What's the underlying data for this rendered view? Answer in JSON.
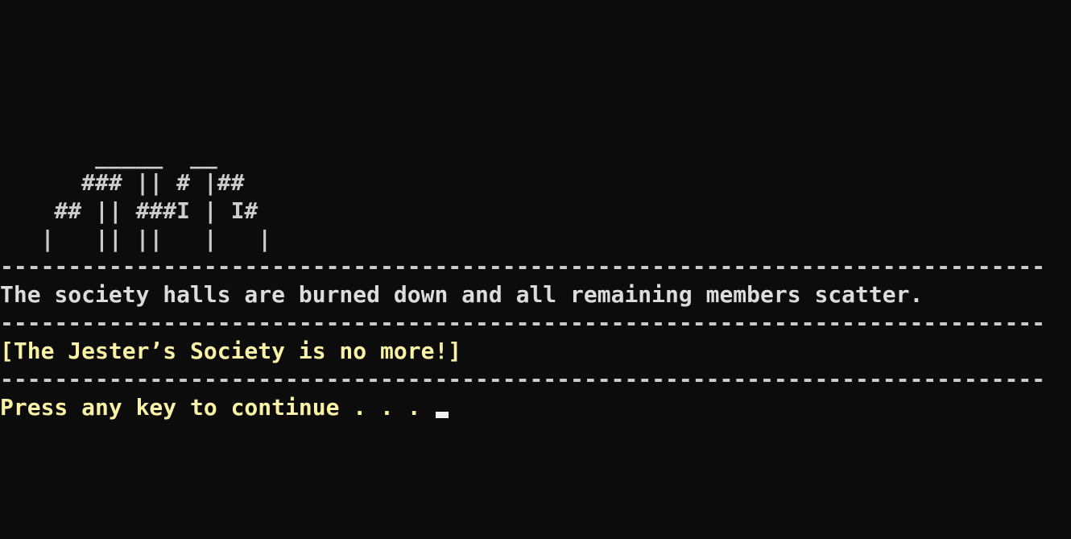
{
  "art_lines": [
    "       _____  __",
    "      ### || # |##",
    "    ## || ###I | I#",
    "   |   || ||   |   |"
  ],
  "divider": "-----------------------------------------------------------------------------",
  "narration": "The society halls are burned down and all remaining members scatter.",
  "announcement": "[The Jester’s Society is no more!]",
  "prompt": "Press any key to continue . . . ",
  "colors": {
    "background": "#0c0c0c",
    "text": "#cccccc",
    "highlight": "#f9f1a5",
    "cursor": "#f2f2f2"
  }
}
